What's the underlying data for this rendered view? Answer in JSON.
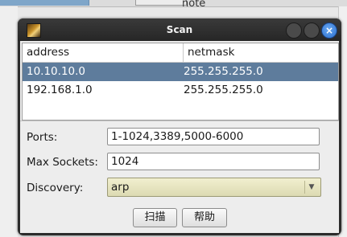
{
  "background": {
    "note_text": "note"
  },
  "dialog": {
    "title": "Scan",
    "close_glyph": "×"
  },
  "table": {
    "columns": [
      "address",
      "netmask"
    ],
    "rows": [
      {
        "address": "10.10.10.0",
        "netmask": "255.255.255.0",
        "selected": true
      },
      {
        "address": "192.168.1.0",
        "netmask": "255.255.255.0",
        "selected": false
      }
    ]
  },
  "form": {
    "ports_label": "Ports:",
    "ports_value": "1-1024,3389,5000-6000",
    "max_sockets_label": "Max Sockets:",
    "max_sockets_value": "1024",
    "discovery_label": "Discovery:",
    "discovery_value": "arp"
  },
  "buttons": {
    "scan_label": "扫描",
    "help_label": "帮助"
  },
  "colors": {
    "selection": "#5e7c9c",
    "titlebar": "#2b2b2b",
    "close_button": "#2a6fd0"
  },
  "icons": [
    "app-icon",
    "minimize-icon",
    "maximize-icon",
    "close-icon",
    "dropdown-arrow-icon"
  ]
}
